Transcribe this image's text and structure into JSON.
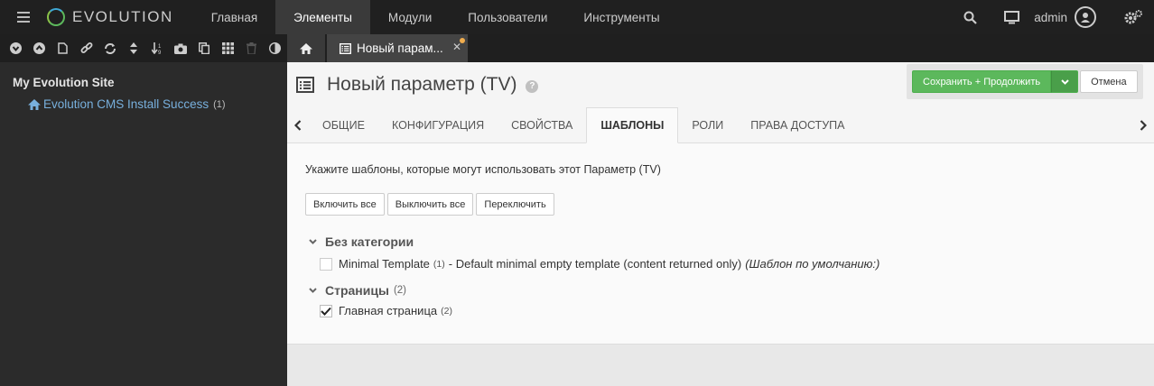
{
  "topbar": {
    "logo": "EVOLUTION",
    "nav": [
      "Главная",
      "Элементы",
      "Модули",
      "Пользователи",
      "Инструменты"
    ],
    "active_nav": 1,
    "user": "admin"
  },
  "sidebar": {
    "site_name": "My Evolution Site",
    "tree": [
      {
        "label": "Evolution CMS Install Success",
        "count": "(1)"
      }
    ]
  },
  "tabstrip": {
    "doc_tab_label": "Новый парам..."
  },
  "header": {
    "title": "Новый параметр (TV)",
    "save_label": "Сохранить + Продолжить",
    "cancel_label": "Отмена"
  },
  "tabs": [
    "ОБЩИЕ",
    "КОНФИГУРАЦИЯ",
    "СВОЙСТВА",
    "ШАБЛОНЫ",
    "РОЛИ",
    "ПРАВА ДОСТУПА"
  ],
  "active_tab": 3,
  "panel": {
    "description": "Укажите шаблоны, которые могут использовать этот Параметр (TV)",
    "buttons": {
      "include_all": "Включить все",
      "exclude_all": "Выключить все",
      "toggle": "Переключить"
    },
    "categories": [
      {
        "name": "Без категории",
        "count": "",
        "templates": [
          {
            "name": "Minimal Template",
            "id": "(1)",
            "description": "- Default minimal empty template (content returned only)",
            "note": "(Шаблон по умолчанию:)",
            "checked": false
          }
        ]
      },
      {
        "name": "Страницы",
        "count": "(2)",
        "templates": [
          {
            "name": "Главная страница",
            "id": "(2)",
            "description": "",
            "note": "",
            "checked": true
          }
        ]
      }
    ]
  },
  "colors": {
    "accent_green": "#5cb85c",
    "link_blue": "#78b0dd",
    "topbar_bg": "#202020"
  }
}
